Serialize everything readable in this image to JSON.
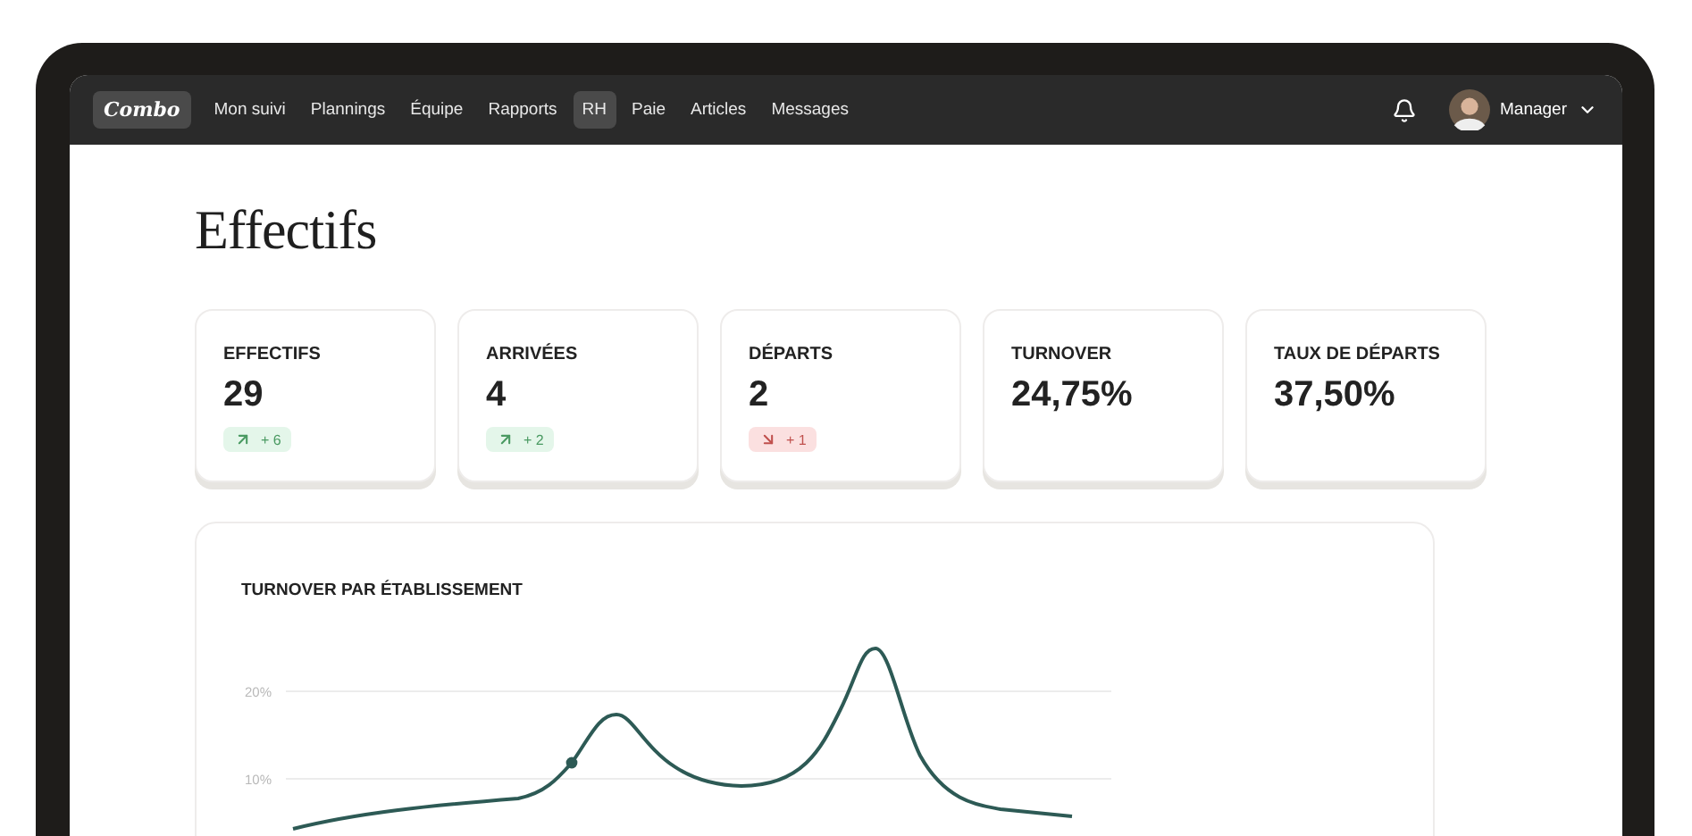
{
  "nav": {
    "logo": "Combo",
    "items": [
      {
        "label": "Mon suivi",
        "selected": false
      },
      {
        "label": "Plannings",
        "selected": false
      },
      {
        "label": "Équipe",
        "selected": false
      },
      {
        "label": "Rapports",
        "selected": false
      },
      {
        "label": "RH",
        "selected": true
      },
      {
        "label": "Paie",
        "selected": false
      },
      {
        "label": "Articles",
        "selected": false
      },
      {
        "label": "Messages",
        "selected": false
      }
    ],
    "user": {
      "name": "Manager"
    }
  },
  "page": {
    "title": "Effectifs"
  },
  "stats": [
    {
      "label": "EFFECTIFS",
      "value": "29",
      "trend": {
        "positive": true,
        "text": "+ 6"
      }
    },
    {
      "label": "ARRIVÉES",
      "value": "4",
      "trend": {
        "positive": true,
        "text": "+ 2"
      }
    },
    {
      "label": "DÉPARTS",
      "value": "2",
      "trend": {
        "positive": false,
        "text": "+ 1"
      }
    },
    {
      "label": "TURNOVER",
      "value": "24,75%"
    },
    {
      "label": "TAUX DE DÉPARTS",
      "value": "37,50%"
    }
  ],
  "chart": {
    "title": "TURNOVER PAR ÉTABLISSEMENT",
    "axis_labels": [
      "20%",
      "10%"
    ]
  }
}
